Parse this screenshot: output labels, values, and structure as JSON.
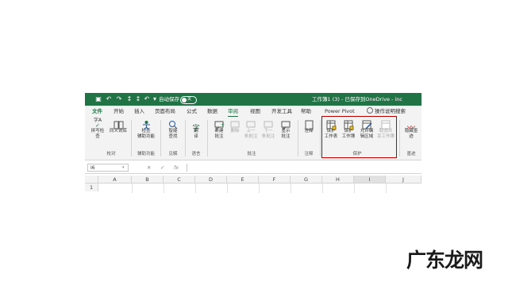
{
  "titlebar": {
    "autosave_label": "自动保存",
    "autosave_state": "关",
    "doc_title": "工作簿1 (3) - 已保存到OneDrive - inc",
    "icons": [
      "save-icon",
      "undo-icon",
      "redo-icon",
      "sort-ascending-icon",
      "sort-descending-icon",
      "undo-icon",
      "dropdown-icon"
    ]
  },
  "tabs": [
    {
      "label": "文件"
    },
    {
      "label": "开始"
    },
    {
      "label": "插入"
    },
    {
      "label": "页面布局"
    },
    {
      "label": "公式"
    },
    {
      "label": "数据"
    },
    {
      "label": "审阅"
    },
    {
      "label": "视图"
    },
    {
      "label": "开发工具"
    },
    {
      "label": "帮助"
    },
    {
      "label": "Power Pivot"
    },
    {
      "label": "操作说明搜索"
    }
  ],
  "ribbon": {
    "buttons": {
      "spell": "拼写检查",
      "thesaurus": "同义词库",
      "check_access": "检查\n辅助功能",
      "smart_lookup": "智能\n查找",
      "translate": "翻\n译",
      "new_comment": "新建\n批注",
      "delete": "删除",
      "prev_comment": "上一\n条批注",
      "next_comment": "下一\n条批注",
      "show_comments": "显示\n批注",
      "notes": "注释",
      "protect_sheet": "保护\n工作表",
      "protect_workbook": "保护\n工作簿",
      "allow_edit": "允许编\n辑区域",
      "unshare": "取消共\n享工作簿",
      "hide_ink": "隐藏墨\n迹"
    },
    "groups": {
      "proofing": "校对",
      "accessibility": "辅助功能",
      "insights": "见解",
      "language": "语言",
      "comments": "批注",
      "notes": "注释",
      "protect": "保护",
      "ink": "墨迹"
    },
    "spell_glyph": "字A",
    "translate_glyph": "字",
    "ink_glyph": "〰"
  },
  "formula_bar": {
    "cell_ref": "I6",
    "cancel": "✕",
    "enter": "✓",
    "fx": "fx"
  },
  "grid": {
    "columns": [
      "A",
      "B",
      "C",
      "D",
      "E",
      "F",
      "G",
      "H",
      "I",
      "J"
    ],
    "rows": [
      "1"
    ]
  },
  "watermark": "广东龙网",
  "colors": {
    "titlebar": "#217346",
    "highlight_box": "#c00000"
  }
}
